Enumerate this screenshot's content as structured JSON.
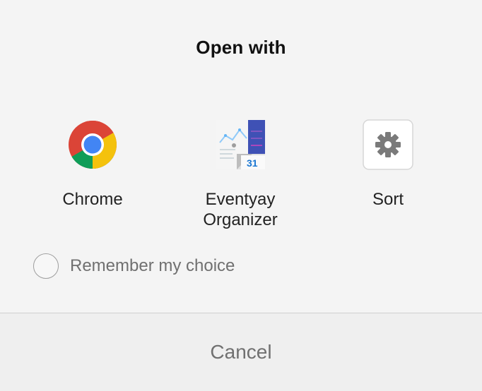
{
  "dialog": {
    "title": "Open with",
    "apps": [
      {
        "label": "Chrome",
        "icon": "chrome-icon"
      },
      {
        "label": "Eventyay\nOrganizer",
        "icon": "eventyay-organizer-icon"
      },
      {
        "label": "Sort",
        "icon": "gear-icon"
      }
    ],
    "remember_label": "Remember my choice",
    "remember_checked": false,
    "cancel_label": "Cancel"
  },
  "colors": {
    "background": "#f4f4f4",
    "title_text": "#111111",
    "secondary_text": "#707070",
    "chrome_red": "#db4437",
    "chrome_yellow": "#f4c20d",
    "chrome_green": "#0f9d58",
    "chrome_blue": "#4285f4"
  }
}
